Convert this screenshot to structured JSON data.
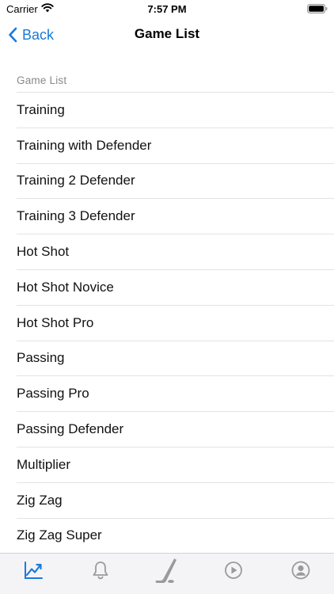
{
  "status_bar": {
    "carrier": "Carrier",
    "time": "7:57 PM"
  },
  "nav": {
    "back_label": "Back",
    "title": "Game List"
  },
  "section": {
    "header": "Game List"
  },
  "games": [
    "Training",
    "Training with Defender",
    "Training 2 Defender",
    "Training 3 Defender",
    "Hot Shot",
    "Hot Shot Novice",
    "Hot Shot Pro",
    "Passing",
    "Passing Pro",
    "Passing Defender",
    "Multiplier",
    "Zig Zag",
    "Zig Zag Super"
  ],
  "tabs": [
    {
      "icon": "chart-trend-icon",
      "active": true
    },
    {
      "icon": "bell-icon",
      "active": false
    },
    {
      "icon": "hockey-stick-icon",
      "active": false
    },
    {
      "icon": "play-circle-icon",
      "active": false
    },
    {
      "icon": "profile-icon",
      "active": false
    }
  ],
  "colors": {
    "accent": "#1a7ad9",
    "inactive": "#9a9a9e",
    "separator": "#e3e3e6"
  }
}
